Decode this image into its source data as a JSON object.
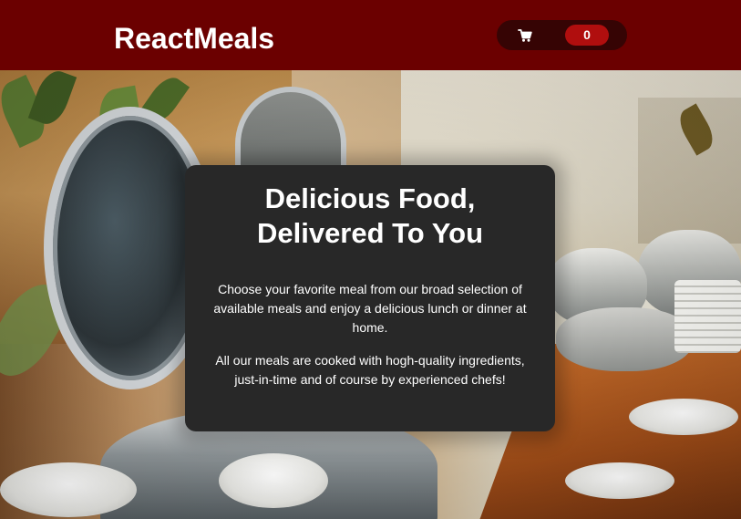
{
  "header": {
    "brand": "ReactMeals",
    "cart": {
      "icon": "cart-icon",
      "count": "0"
    }
  },
  "summary": {
    "title_line1": "Delicious Food,",
    "title_line2": "Delivered To You",
    "paragraph1": "Choose your favorite meal from our broad selection of available meals and enjoy a delicious lunch or dinner at home.",
    "paragraph2": "All our meals are cooked with hogh-quality ingredients, just-in-time and of course by experienced chefs!"
  },
  "colors": {
    "header_bg": "#6b0000",
    "cart_button_bg": "#360404",
    "cart_badge_bg": "#b00e0e",
    "summary_bg": "#282828"
  }
}
